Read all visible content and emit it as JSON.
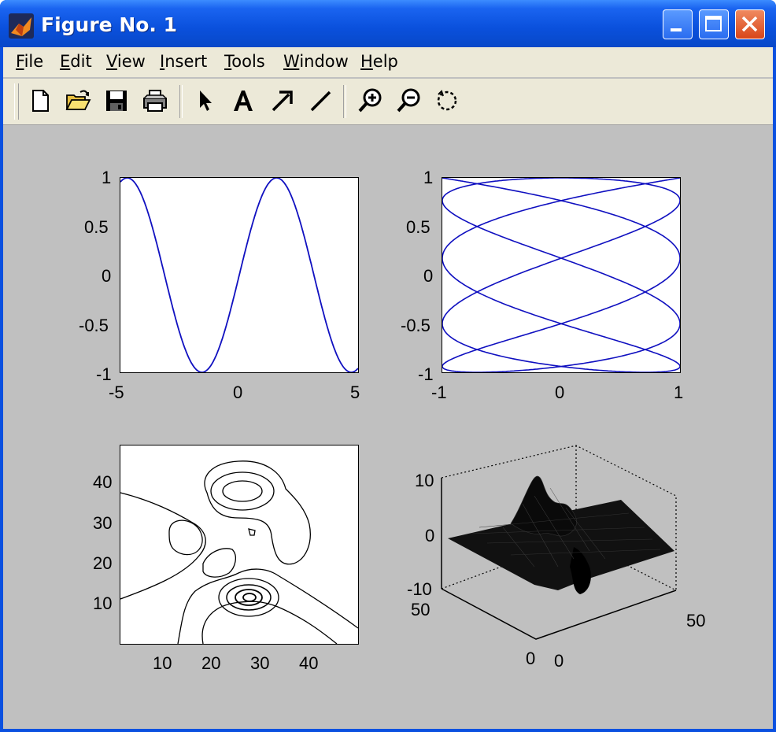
{
  "window": {
    "title": "Figure No. 1",
    "accent": "#0a50e0"
  },
  "menu": {
    "items": [
      {
        "u": "F",
        "rest": "ile"
      },
      {
        "u": "E",
        "rest": "dit"
      },
      {
        "u": "V",
        "rest": "iew"
      },
      {
        "u": "I",
        "rest": "nsert"
      },
      {
        "u": "T",
        "rest": "ools"
      },
      {
        "u": "W",
        "rest": "indow"
      },
      {
        "u": "H",
        "rest": "elp"
      }
    ]
  },
  "toolbar": {
    "icons": [
      "new-file-icon",
      "open-folder-icon",
      "save-icon",
      "print-icon",
      "select-arrow-icon",
      "text-icon",
      "arrow-icon",
      "line-icon",
      "zoom-in-icon",
      "zoom-out-icon",
      "rotate-icon"
    ]
  },
  "plots": {
    "p1": {
      "yticks": [
        "1",
        "0.5",
        "0",
        "-0.5",
        "-1"
      ],
      "xticks": [
        "-5",
        "0",
        "5"
      ]
    },
    "p2": {
      "yticks": [
        "1",
        "0.5",
        "0",
        "-0.5",
        "-1"
      ],
      "xticks": [
        "-1",
        "0",
        "1"
      ]
    },
    "p3": {
      "yticks": [
        "40",
        "30",
        "20",
        "10"
      ],
      "xticks": [
        "10",
        "20",
        "30",
        "40"
      ]
    },
    "p4": {
      "zticks": [
        "10",
        "0",
        "-10"
      ],
      "ytick_left": "50",
      "xtick_right": "50",
      "bottom_zero_1": "0",
      "bottom_zero_2": "0"
    }
  },
  "chart_data": [
    {
      "type": "line",
      "series": [
        {
          "color": "#1010c0"
        }
      ],
      "x_range": [
        -5,
        5
      ],
      "ylim": [
        -1,
        1
      ],
      "function": "sin(x)"
    },
    {
      "type": "line",
      "series": [
        {
          "color": "#1010c0"
        }
      ],
      "xlim": [
        -1,
        1
      ],
      "ylim": [
        -1,
        1
      ],
      "function": "lissajous"
    },
    {
      "type": "contour",
      "xlim": [
        1,
        49
      ],
      "ylim": [
        1,
        49
      ],
      "color": "#000000"
    },
    {
      "type": "surface",
      "zlim": [
        -10,
        10
      ],
      "x_range": [
        0,
        50
      ],
      "y_range": [
        0,
        50
      ],
      "color": "#000000"
    }
  ]
}
